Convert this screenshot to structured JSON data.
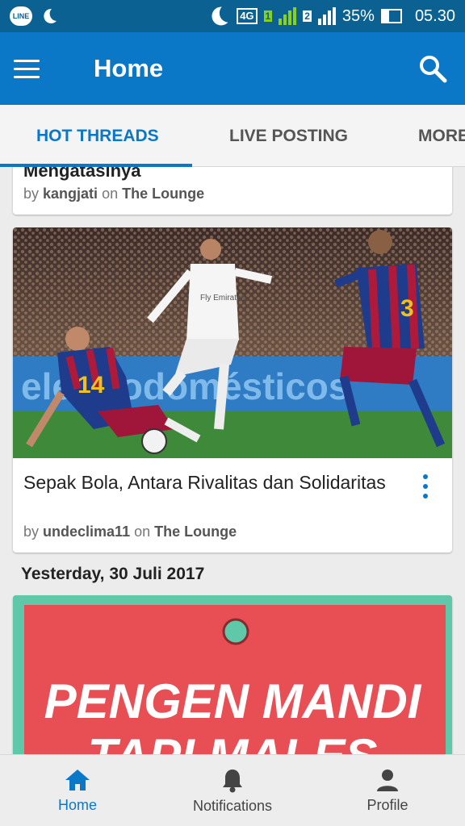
{
  "status_bar": {
    "line_label": "LINE",
    "network": "4G",
    "sim1": "1",
    "sim2": "2",
    "battery": "35%",
    "battery_level": 0.35,
    "time": "05.30"
  },
  "app_bar": {
    "title": "Home"
  },
  "tabs": [
    {
      "label": "HOT THREADS",
      "active": true
    },
    {
      "label": "LIVE POSTING",
      "active": false
    },
    {
      "label": "MORE",
      "active": false
    }
  ],
  "feed": {
    "cards": [
      {
        "title": "Mengatasinya",
        "by": "by",
        "author": "kangjati",
        "on": "on",
        "forum": "The Lounge"
      },
      {
        "title": "Sepak Bola, Antara Rivalitas dan Solidaritas",
        "by": "by",
        "author": "undeclima11",
        "on": "on",
        "forum": "The Lounge",
        "photo_text": "electrodomésticos",
        "jersey_left": "14",
        "jersey_right": "3",
        "jersey_center": "Fly Emirates"
      }
    ],
    "date_header": "Yesterday, 30 Juli 2017",
    "meme_card": {
      "line1": "PENGEN MANDI",
      "line2": "TAPI MALES"
    }
  },
  "bottom_nav": [
    {
      "label": "Home",
      "icon": "home-icon",
      "active": true
    },
    {
      "label": "Notifications",
      "icon": "bell-icon",
      "active": false
    },
    {
      "label": "Profile",
      "icon": "person-icon",
      "active": false
    }
  ],
  "colors": {
    "status_bar": "#0a6192",
    "app_bar": "#0a78c7",
    "accent": "#0a78c7",
    "meme_red": "#e84f55",
    "meme_border": "#5ec8a8"
  }
}
